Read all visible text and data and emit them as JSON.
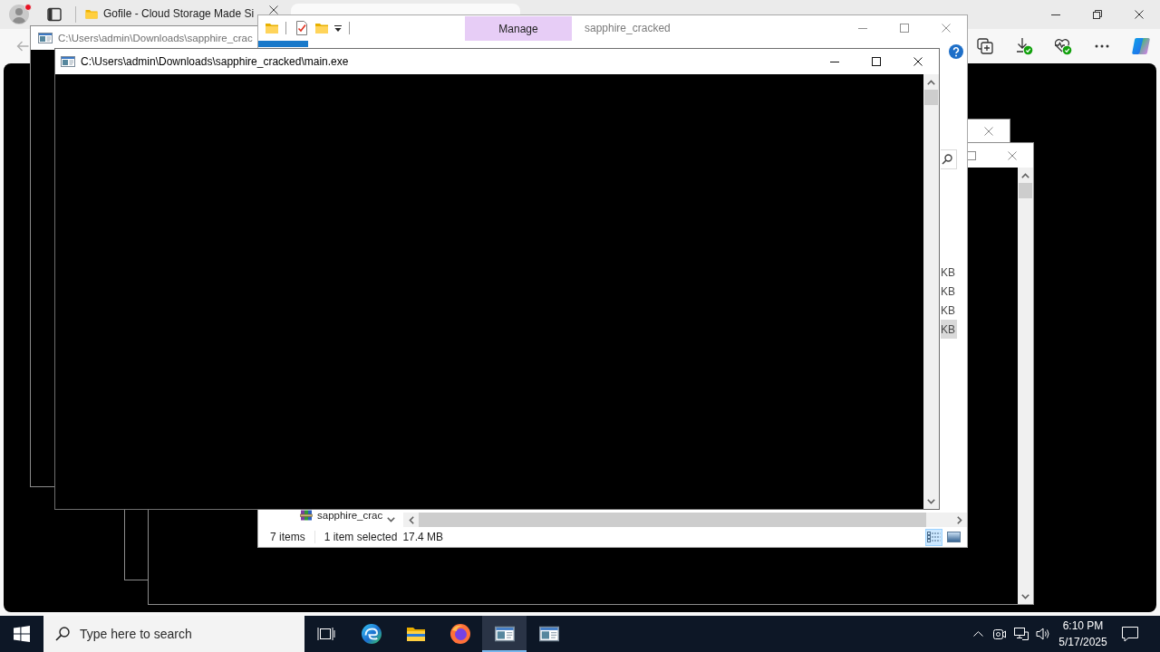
{
  "browser": {
    "tabs": [
      {
        "title": "Gofile - Cloud Storage Made Si",
        "selected": false
      },
      {
        "selected": true
      }
    ]
  },
  "background_window": {
    "title": "C:\\Users\\admin\\Downloads\\sapphire_crac"
  },
  "explorer": {
    "context_tab": "Manage",
    "title": "sapphire_cracked",
    "size_cells": [
      {
        "text": "KB",
        "selected": false
      },
      {
        "text": "KB",
        "selected": false
      },
      {
        "text": "KB",
        "selected": false
      },
      {
        "text": "KB",
        "selected": true
      }
    ],
    "nav_item": "sapphire_crac",
    "status_bar": {
      "item_count": "7 items",
      "selection": "1 item selected",
      "selection_size": "17.4 MB"
    },
    "view_buttons": [
      {
        "kind": "details",
        "selected": true
      },
      {
        "kind": "large_icons",
        "selected": false
      }
    ]
  },
  "console_window": {
    "title": "C:\\Users\\admin\\Downloads\\sapphire_cracked\\main.exe"
  },
  "taskbar": {
    "search": {
      "placeholder": "Type here to search"
    },
    "apps": [
      {
        "kind": "edge",
        "selected": false
      },
      {
        "kind": "explorer",
        "selected": false
      },
      {
        "kind": "firefox",
        "selected": false
      },
      {
        "kind": "console",
        "selected": true
      },
      {
        "kind": "console",
        "selected": false
      }
    ],
    "clock": {
      "time": "6:10 PM",
      "date": "5/17/2025"
    }
  }
}
